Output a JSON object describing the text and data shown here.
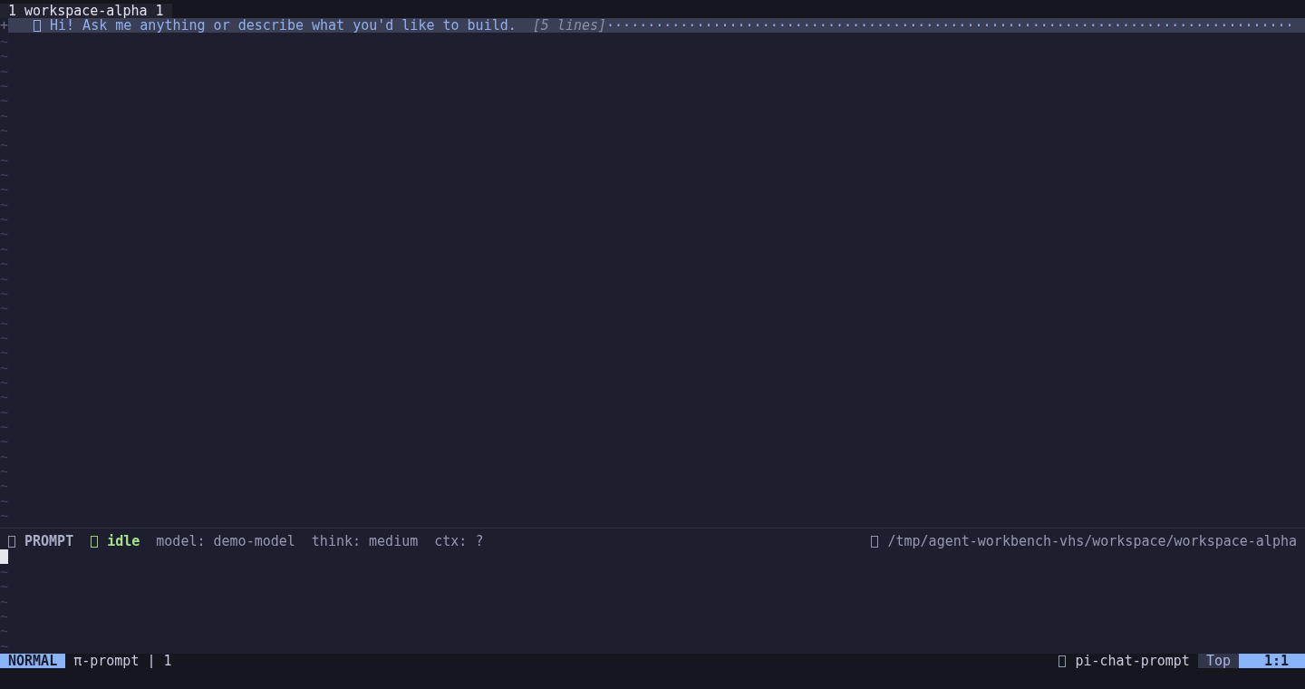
{
  "tabline": {
    "tabs": [
      {
        "label": "1 workspace-alpha 1",
        "selected": true
      }
    ]
  },
  "fold": {
    "sign": "+",
    "text": "Hi! Ask me anything or describe what you'd like to build.",
    "info": "[5 lines]",
    "fill": "····················································································"
  },
  "upper_fillers": [
    "~",
    "~",
    "~",
    "~",
    "~",
    "~",
    "~",
    "~",
    "~",
    "~",
    "~",
    "~",
    "~",
    "~",
    "~",
    "~",
    "~",
    "~",
    "~",
    "~",
    "~",
    "~",
    "~",
    "~",
    "~",
    "~",
    "~",
    "~",
    "~",
    "~",
    "~",
    "~",
    "~"
  ],
  "prompt_bar": {
    "title": "PROMPT",
    "status": "idle",
    "model": "model: demo-model",
    "think": "think: medium",
    "ctx": "ctx: ?",
    "path": "/tmp/agent-workbench-vhs/workspace/workspace-alpha"
  },
  "lower_fillers": [
    "~",
    "~",
    "~",
    "~",
    "~",
    "~"
  ],
  "statusline": {
    "mode": "NORMAL",
    "buffer": "π-prompt | 1",
    "filetype": "pi-chat-prompt",
    "position": "Top",
    "cursor": "1:1"
  }
}
